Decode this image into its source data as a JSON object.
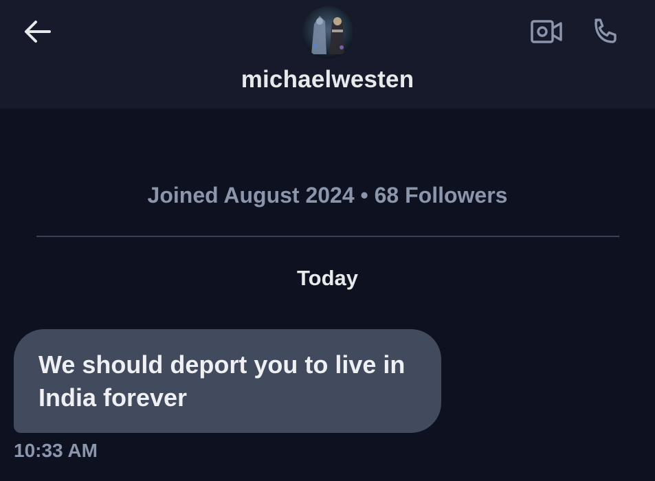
{
  "header": {
    "username": "michaelwesten",
    "back_icon": "arrow-left-icon",
    "video_icon": "video-call-icon",
    "call_icon": "phone-icon"
  },
  "profile": {
    "meta": "Joined August 2024 • 68 Followers"
  },
  "conversation": {
    "date_separator": "Today",
    "messages": [
      {
        "text": "We should deport you to live in India forever",
        "time": "10:33 AM",
        "direction": "incoming"
      }
    ]
  },
  "colors": {
    "background": "#0d1120",
    "header": "#161a2a",
    "bubble": "#424a5d",
    "muted_text": "#8b96ac",
    "primary_text": "#e7e9ea"
  }
}
